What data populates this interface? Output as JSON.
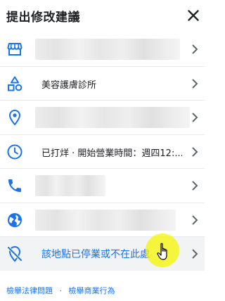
{
  "dialog": {
    "title": "提出修改建議"
  },
  "rows": [
    {
      "icon": "storefront-icon",
      "text": ""
    },
    {
      "icon": "category-shapes-icon",
      "text": "美容護膚診所"
    },
    {
      "icon": "location-pin-icon",
      "text": ""
    },
    {
      "icon": "clock-icon",
      "text": "已打烊 · 開始營業時間：週四12:..."
    },
    {
      "icon": "phone-icon",
      "text": ""
    },
    {
      "icon": "globe-icon",
      "text": ""
    },
    {
      "icon": "location-off-icon",
      "text": "該地點已停業或不在此處"
    }
  ],
  "footer": {
    "report_legal": "檢舉法律問題",
    "separator": "·",
    "report_business": "檢舉商業行為"
  },
  "colors": {
    "accent": "#1a73e8",
    "icon": "#1a73e8",
    "cursor_highlight": "#f5f500"
  }
}
